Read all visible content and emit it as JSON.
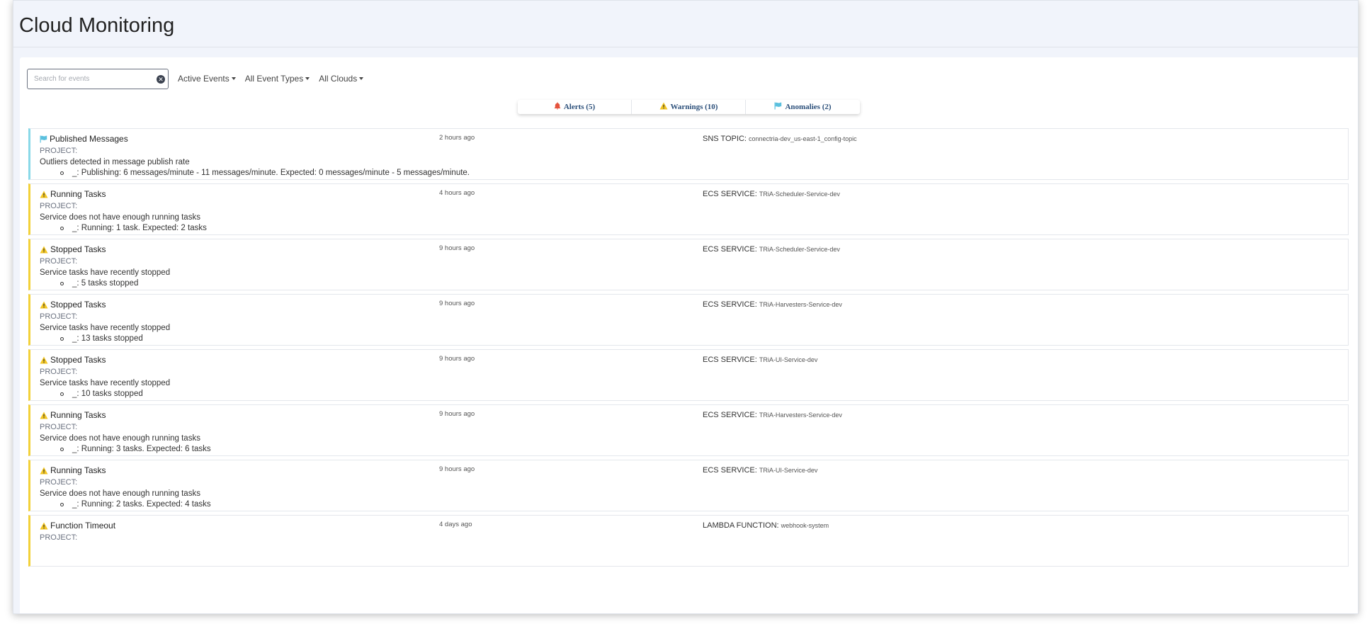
{
  "page": {
    "title": "Cloud Monitoring"
  },
  "toolbar": {
    "search_placeholder": "Search for events",
    "search_value": "",
    "filters": [
      "Active Events",
      "All Event Types",
      "All Clouds"
    ]
  },
  "tabs": [
    {
      "label": "Alerts (5)",
      "icon": "bell-icon",
      "color": "#e5533d"
    },
    {
      "label": "Warnings (10)",
      "icon": "warning-icon",
      "color": "#f3c623"
    },
    {
      "label": "Anomalies (2)",
      "icon": "flag-icon",
      "color": "#5bc0de"
    }
  ],
  "events": [
    {
      "kind": "anomaly",
      "title": "Published Messages",
      "time": "2 hours ago",
      "resource_label": "SNS TOPIC:",
      "resource_value": "connectria-dev_us-east-1_config-topic",
      "project_label": "PROJECT:",
      "description": "Outliers detected in message publish rate",
      "detail": "_: Publishing: 6 messages/minute - 11 messages/minute. Expected: 0 messages/minute - 5 messages/minute."
    },
    {
      "kind": "warning",
      "title": "Running Tasks",
      "time": "4 hours ago",
      "resource_label": "ECS SERVICE:",
      "resource_value": "TRiA-Scheduler-Service-dev",
      "project_label": "PROJECT:",
      "description": "Service does not have enough running tasks",
      "detail": "_: Running: 1 task. Expected: 2 tasks"
    },
    {
      "kind": "warning",
      "title": "Stopped Tasks",
      "time": "9 hours ago",
      "resource_label": "ECS SERVICE:",
      "resource_value": "TRiA-Scheduler-Service-dev",
      "project_label": "PROJECT:",
      "description": "Service tasks have recently stopped",
      "detail": "_: 5 tasks stopped"
    },
    {
      "kind": "warning",
      "title": "Stopped Tasks",
      "time": "9 hours ago",
      "resource_label": "ECS SERVICE:",
      "resource_value": "TRiA-Harvesters-Service-dev",
      "project_label": "PROJECT:",
      "description": "Service tasks have recently stopped",
      "detail": "_: 13 tasks stopped"
    },
    {
      "kind": "warning",
      "title": "Stopped Tasks",
      "time": "9 hours ago",
      "resource_label": "ECS SERVICE:",
      "resource_value": "TRiA-UI-Service-dev",
      "project_label": "PROJECT:",
      "description": "Service tasks have recently stopped",
      "detail": "_: 10 tasks stopped"
    },
    {
      "kind": "warning",
      "title": "Running Tasks",
      "time": "9 hours ago",
      "resource_label": "ECS SERVICE:",
      "resource_value": "TRiA-Harvesters-Service-dev",
      "project_label": "PROJECT:",
      "description": "Service does not have enough running tasks",
      "detail": "_: Running: 3 tasks. Expected: 6 tasks"
    },
    {
      "kind": "warning",
      "title": "Running Tasks",
      "time": "9 hours ago",
      "resource_label": "ECS SERVICE:",
      "resource_value": "TRiA-UI-Service-dev",
      "project_label": "PROJECT:",
      "description": "Service does not have enough running tasks",
      "detail": "_: Running: 2 tasks. Expected: 4 tasks"
    },
    {
      "kind": "warning",
      "title": "Function Timeout",
      "time": "4 days ago",
      "resource_label": "LAMBDA FUNCTION:",
      "resource_value": "webhook-system",
      "project_label": "PROJECT:",
      "description": "",
      "detail": ""
    }
  ]
}
